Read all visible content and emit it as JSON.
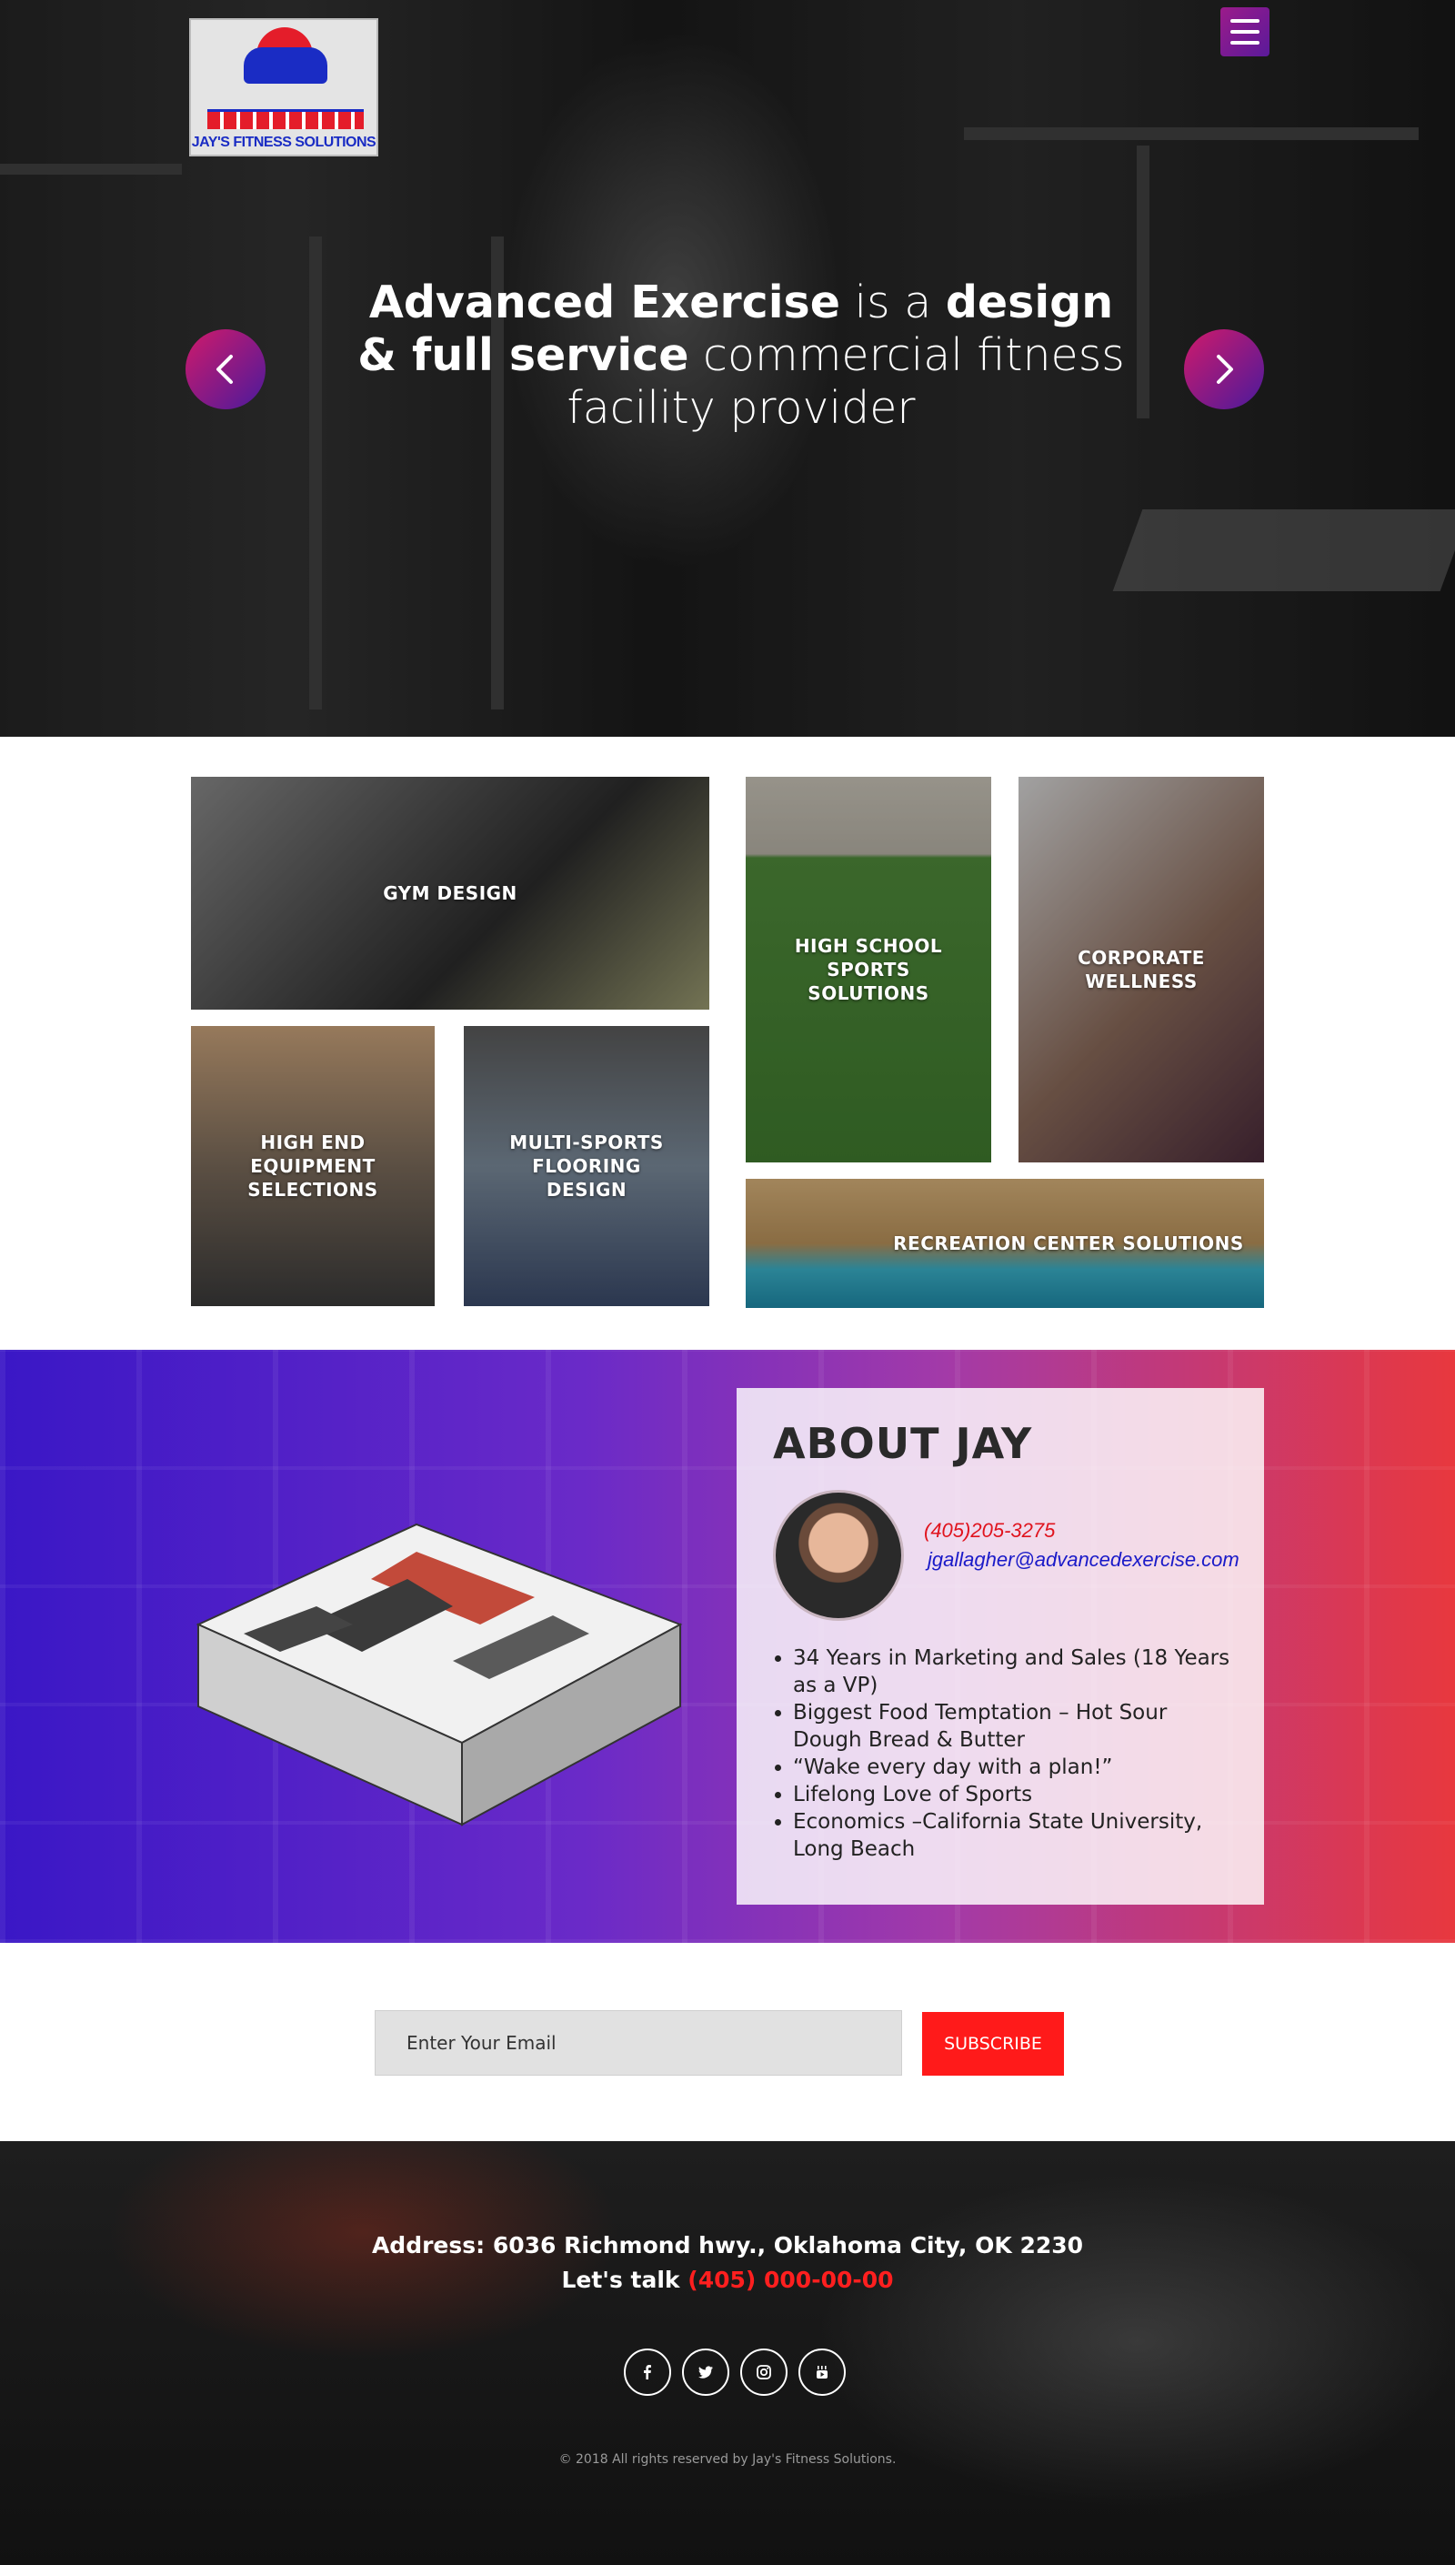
{
  "header": {
    "logo_text": "JAY'S FITNESS SOLUTIONS",
    "menu_icon": "hamburger-icon"
  },
  "hero": {
    "part1_bold": "Advanced Exercise",
    "part2": " is a ",
    "part3_bold": "design",
    "part4_bold": "& full service",
    "part5": " commercial fitness",
    "part6": "facility provider",
    "prev_icon": "chevron-left-icon",
    "next_icon": "chevron-right-icon"
  },
  "services": [
    {
      "label": "GYM DESIGN"
    },
    {
      "label": "HIGH SCHOOL SPORTS SOLUTIONS"
    },
    {
      "label": "CORPORATE WELLNESS"
    },
    {
      "label": "HIGH END EQUIPMENT SELECTIONS"
    },
    {
      "label": "MULTI-SPORTS FLOORING DESIGN"
    },
    {
      "label": "RECREATION CENTER SOLUTIONS"
    }
  ],
  "about": {
    "title": "ABOUT JAY",
    "phone": "(405)205-3275",
    "email": "jgallagher@advancedexercise.com",
    "facts": [
      "34 Years in Marketing and Sales (18 Years as a VP)",
      "Biggest Food Temptation – Hot Sour Dough Bread & Butter",
      "“Wake every day with a plan!”",
      "Lifelong Love of Sports",
      "Economics –California State University, Long Beach"
    ]
  },
  "subscribe": {
    "placeholder": "Enter Your Email",
    "button_label": "SUBSCRIBE"
  },
  "footer": {
    "address": "Address: 6036 Richmond hwy., Oklahoma City, OK 2230",
    "talk_label": "Let's talk ",
    "talk_number": "(405) 000-00-00",
    "social": [
      "facebook-icon",
      "twitter-icon",
      "instagram-icon",
      "youtube-icon"
    ],
    "copyright": "© 2018 All rights reserved by Jay's Fitness Solutions."
  },
  "colors": {
    "accent_red": "#ff1a1a",
    "accent_purple": "#5a1a9a",
    "about_gradient_start": "#3a17c6",
    "about_gradient_end": "#e8383e"
  }
}
